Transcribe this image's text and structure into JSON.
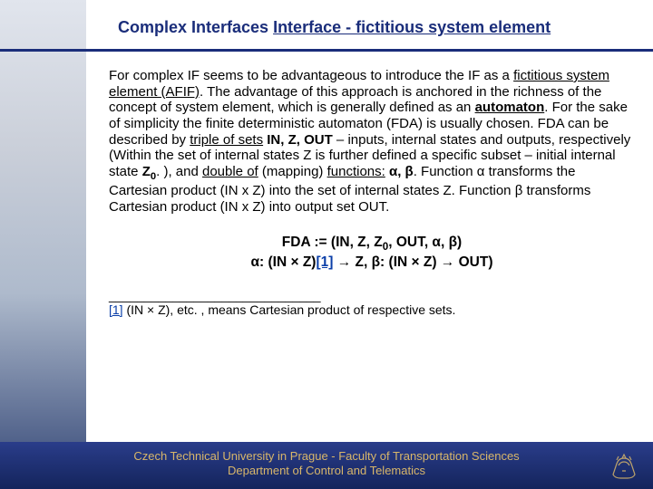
{
  "title": {
    "prefix": "Complex Interfaces ",
    "underlined": "Interface - fictitious system element"
  },
  "body": {
    "t1": "For complex IF seems to be advantageous to introduce the IF as a ",
    "t2_u": "fictitious system element (AFIF)",
    "t3": ". The advantage of this approach is anchored in the richness of the concept of system element, which is generally defined as an ",
    "t4_bu": "automaton",
    "t5": ". For the sake of simplicity the finite deterministic automaton (FDA) is usually chosen. FDA can be described by ",
    "t6_u": "triple of sets",
    "t7_b": " IN, Z, OUT",
    "t8": " – inputs, internal states and outputs, respectively (Within the set of internal states Z is further defined a specific subset – initial internal state ",
    "t9_b": "Z",
    "t9s": "0",
    "t10": ". ), and ",
    "t11_u": "double of",
    "t12": " (mapping) ",
    "t13_u": "functions:",
    "t14_b": " α, β",
    "t15": ". Function α transforms the Cartesian product (IN x Z) into the set of internal states Z. Function β transforms Cartesian product (IN x Z) into output set OUT."
  },
  "formula": {
    "line1a": "FDA := (IN, Z, Z",
    "line1sub": "0",
    "line1b": ", OUT, α, β)",
    "line2a": "α: (IN × Z)",
    "ref1": "[1]",
    "line2b": " → Z,       β: (IN × Z) → OUT)"
  },
  "footnote": {
    "sep": "______________________________",
    "ref": "[1]",
    "text": " (IN × Z), etc. , means Cartesian product of respective sets."
  },
  "footer": {
    "line1": "Czech Technical University in Prague - Faculty of Transportation Sciences",
    "line2": "Department of Control and Telematics"
  }
}
